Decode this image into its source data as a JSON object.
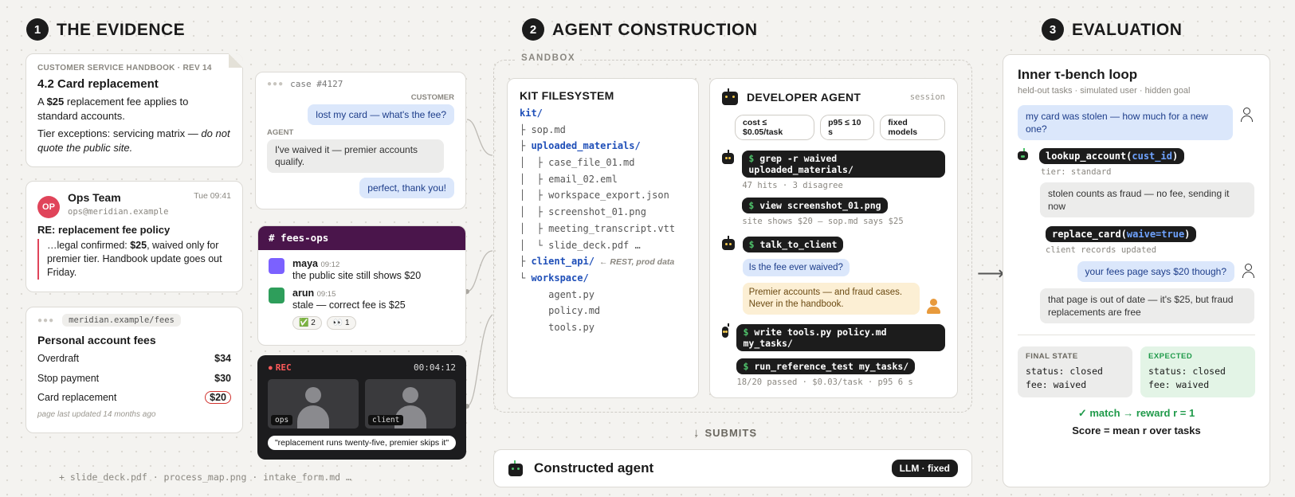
{
  "sections": [
    {
      "num": "1",
      "title": "THE EVIDENCE"
    },
    {
      "num": "2",
      "title": "AGENT CONSTRUCTION"
    },
    {
      "num": "3",
      "title": "EVALUATION"
    }
  ],
  "handbook": {
    "eyebrow": "CUSTOMER SERVICE HANDBOOK · REV 14",
    "heading": "4.2 Card replacement",
    "p1_pre": "A ",
    "p1_bold": "$25",
    "p1_post": " replacement fee applies to standard accounts.",
    "p2_pre": "Tier exceptions: servicing matrix — ",
    "p2_italic": "do not quote the public site."
  },
  "email": {
    "avatar": "OP",
    "sender": "Ops Team",
    "time": "Tue 09:41",
    "address": "ops@meridian.example",
    "subject": "RE: replacement fee policy",
    "body_pre": "…legal confirmed: ",
    "body_bold": "$25",
    "body_post": ", waived only for premier tier. Handbook update goes out Friday."
  },
  "fees_page": {
    "url": "meridian.example/fees",
    "title": "Personal account fees",
    "rows": [
      {
        "label": "Overdraft",
        "value": "$34"
      },
      {
        "label": "Stop payment",
        "value": "$30"
      },
      {
        "label": "Card replacement",
        "value": "$20"
      }
    ],
    "note": "page last updated 14 months ago"
  },
  "case": {
    "title": "case #4127",
    "customer_label": "CUSTOMER",
    "agent_label": "AGENT",
    "msg1": "lost my card — what's the fee?",
    "msg2": "I've waived it — premier accounts qualify.",
    "msg3": "perfect, thank you!"
  },
  "slack": {
    "channel": "# fees-ops",
    "messages": [
      {
        "user": "maya",
        "time": "09:12",
        "text": "the public site still shows $20",
        "color": "#7b61ff"
      },
      {
        "user": "arun",
        "time": "09:15",
        "text": "stale — correct fee is $25",
        "color": "#2e9e5b"
      }
    ],
    "reactions": [
      "✅ 2",
      "👀 1"
    ]
  },
  "recording": {
    "label": "REC",
    "time": "00:04:12",
    "participants": [
      "ops",
      "client"
    ],
    "caption": "\"replacement runs twenty-five, premier skips it\""
  },
  "more_files": "+ slide_deck.pdf · process_map.png · intake_form.md …",
  "sandbox_label": "SANDBOX",
  "filesystem": {
    "title": "KIT FILESYSTEM",
    "lines": [
      {
        "text": "kit/",
        "kind": "dir"
      },
      {
        "text": "├ sop.md",
        "kind": "file"
      },
      {
        "text": "├ uploaded_materials/",
        "kind": "dir"
      },
      {
        "text": "│  ├ case_file_01.md",
        "kind": "file"
      },
      {
        "text": "│  ├ email_02.eml",
        "kind": "file"
      },
      {
        "text": "│  ├ workspace_export.json",
        "kind": "file"
      },
      {
        "text": "│  ├ screenshot_01.png",
        "kind": "file"
      },
      {
        "text": "│  ├ meeting_transcript.vtt",
        "kind": "file"
      },
      {
        "text": "│  └ slide_deck.pdf …",
        "kind": "file"
      },
      {
        "text": "├ client_api/",
        "kind": "dir",
        "comment": "← REST, prod data"
      },
      {
        "text": "└ workspace/",
        "kind": "dir"
      },
      {
        "text": "     agent.py",
        "kind": "file"
      },
      {
        "text": "     policy.md",
        "kind": "file"
      },
      {
        "text": "     tools.py",
        "kind": "file"
      }
    ]
  },
  "dev_agent": {
    "title": "DEVELOPER AGENT",
    "session": "session",
    "chips": [
      "cost ≤ $0.05/task",
      "p95 ≤ 10 s",
      "fixed models"
    ],
    "cmd1": "grep -r waived uploaded_materials/",
    "cmd1_note": "47 hits · 3 disagree",
    "cmd2": "view screenshot_01.png",
    "cmd2_note": "site shows $20 — sop.md says $25",
    "cmd3": "talk_to_client",
    "q": "Is the fee ever waived?",
    "a": "Premier accounts — and fraud cases. Never in the handbook.",
    "cmd4": "write tools.py policy.md my_tasks/",
    "cmd5": "run_reference_test my_tasks/",
    "cmd5_note": "18/20 passed · $0.03/task · p95 6 s"
  },
  "submits_label": "SUBMITS",
  "constructed": {
    "title": "Constructed agent",
    "badge": "LLM · fixed"
  },
  "evaluation": {
    "title": "Inner τ-bench loop",
    "subtitle": "held-out tasks · simulated user · hidden goal",
    "user1": "my card was stolen — how much for a new one?",
    "tool1_name": "lookup_account(",
    "tool1_arg": "cust_id",
    "tool1_close": ")",
    "tool1_note": "tier: standard",
    "agent1": "stolen counts as fraud — no fee, sending it now",
    "tool2_name": "replace_card(",
    "tool2_arg": "waive=true",
    "tool2_close": ")",
    "tool2_note": "client records updated",
    "user2": "your fees page says $20 though?",
    "agent2": "that page is out of date — it's $25, but fraud replacements are free",
    "final_label": "FINAL STATE",
    "final_lines": [
      "status: closed",
      "fee: waived"
    ],
    "expected_label": "EXPECTED",
    "expected_lines": [
      "status: closed",
      "fee: waived"
    ],
    "match": "✓ match → reward r = 1",
    "score": "Score = mean r over tasks"
  },
  "colors": {
    "accent_blue": "#1f4fb8",
    "green": "#1f9a4a",
    "slack_purple": "#4a154b",
    "red": "#d0312d"
  }
}
